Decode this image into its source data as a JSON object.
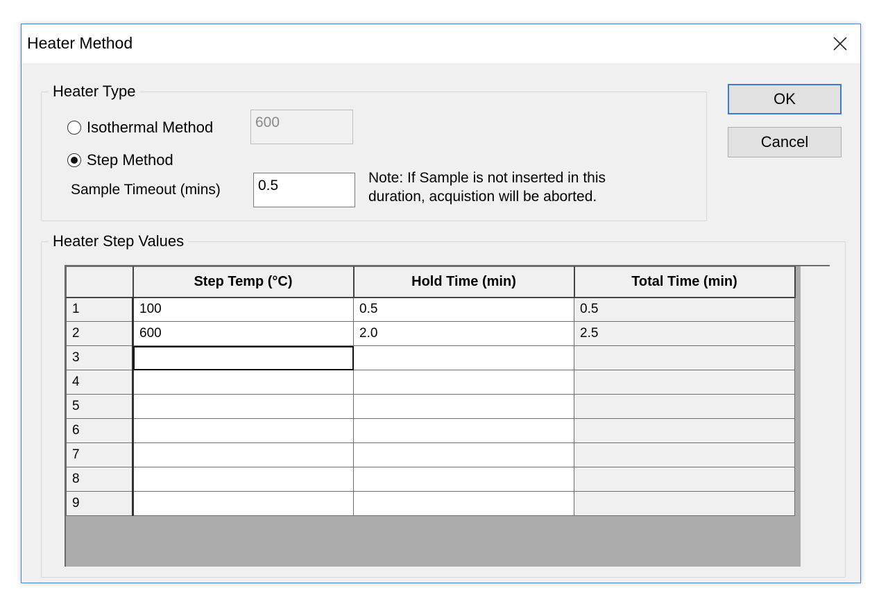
{
  "window": {
    "title": "Heater Method"
  },
  "heater_type": {
    "legend": "Heater Type",
    "isothermal_label": "Isothermal Method",
    "isothermal_value": "600",
    "step_label": "Step Method",
    "selected": "step",
    "timeout_label": "Sample Timeout (mins)",
    "timeout_value": "0.5",
    "note_line1": "Note: If Sample is not inserted in this",
    "note_line2": "duration, acquistion will be aborted."
  },
  "buttons": {
    "ok": "OK",
    "cancel": "Cancel"
  },
  "step_values": {
    "legend": "Heater Step Values",
    "columns": [
      "",
      "Step Temp (°C)",
      "Hold Time (min)",
      "Total Time (min)"
    ],
    "rows": [
      [
        "1",
        "100",
        "0.5",
        "0.5"
      ],
      [
        "2",
        "600",
        "2.0",
        "2.5"
      ],
      [
        "3",
        "",
        "",
        ""
      ],
      [
        "4",
        "",
        "",
        ""
      ],
      [
        "5",
        "",
        "",
        ""
      ],
      [
        "6",
        "",
        "",
        ""
      ],
      [
        "7",
        "",
        "",
        ""
      ],
      [
        "8",
        "",
        "",
        ""
      ],
      [
        "9",
        "",
        "",
        ""
      ]
    ]
  },
  "icons": {
    "close": "close-icon"
  }
}
